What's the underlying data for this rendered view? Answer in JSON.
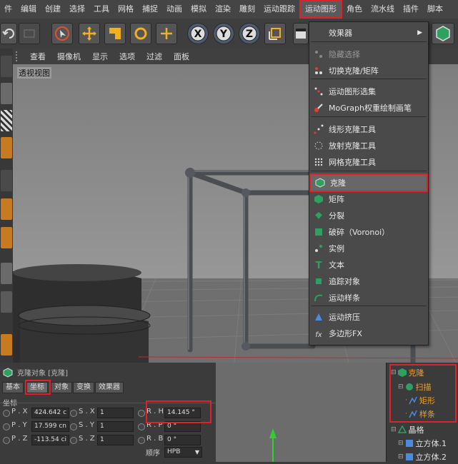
{
  "menubar": {
    "items": [
      "件",
      "编辑",
      "创建",
      "选择",
      "工具",
      "网格",
      "捕捉",
      "动画",
      "模拟",
      "渲染",
      "雕刻",
      "运动跟踪",
      "运动图形",
      "角色",
      "流水线",
      "插件",
      "脚本"
    ],
    "active_index": 12
  },
  "viewport_menu": [
    "查看",
    "摄像机",
    "显示",
    "选项",
    "过滤",
    "面板"
  ],
  "viewport_label": "透视视图",
  "dropdown": {
    "items": [
      {
        "label": "效果器",
        "icon": "submenu-arrow",
        "type": "submenu"
      },
      {
        "label": "隐藏选择",
        "icon": "hide-selection-icon",
        "type": "disabled"
      },
      {
        "label": "切换克隆/矩阵",
        "icon": "toggle-clone-matrix-icon",
        "type": "normal"
      },
      {
        "label": "运动图形选集",
        "icon": "mograph-selection-icon",
        "type": "normal"
      },
      {
        "label": "MoGraph权重绘制画笔",
        "icon": "weight-brush-icon",
        "type": "normal"
      },
      {
        "label": "线形克隆工具",
        "icon": "linear-clone-icon",
        "type": "normal"
      },
      {
        "label": "放射克隆工具",
        "icon": "radial-clone-icon",
        "type": "normal"
      },
      {
        "label": "网格克隆工具",
        "icon": "grid-clone-icon",
        "type": "normal"
      },
      {
        "label": "克隆",
        "icon": "cloner-icon",
        "type": "highlight"
      },
      {
        "label": "矩阵",
        "icon": "matrix-icon",
        "type": "normal"
      },
      {
        "label": "分裂",
        "icon": "fracture-icon",
        "type": "normal"
      },
      {
        "label": "破碎（Voronoi）",
        "icon": "voronoi-icon",
        "type": "normal"
      },
      {
        "label": "实例",
        "icon": "instance-icon",
        "type": "normal"
      },
      {
        "label": "文本",
        "icon": "text-icon",
        "type": "normal"
      },
      {
        "label": "追踪对象",
        "icon": "tracer-icon",
        "type": "normal"
      },
      {
        "label": "运动样条",
        "icon": "mospline-icon",
        "type": "normal"
      },
      {
        "label": "运动挤压",
        "icon": "moextrude-icon",
        "type": "normal"
      },
      {
        "label": "多边形FX",
        "icon": "polyfx-icon",
        "type": "normal"
      }
    ]
  },
  "props": {
    "title": "克隆对象 [克隆]",
    "tabs": [
      "基本",
      "坐标",
      "对象",
      "变换",
      "效果器"
    ],
    "active_tab": "坐标",
    "section": "坐标",
    "rows": [
      {
        "p_label": "P . X",
        "p_val": "424.642 c",
        "s_label": "S . X",
        "s_val": "1",
        "r_label": "R . H",
        "r_val": "14.145 °"
      },
      {
        "p_label": "P . Y",
        "p_val": "17.599 cn",
        "s_label": "S . Y",
        "s_val": "1",
        "r_label": "R . P",
        "r_val": "0 °"
      },
      {
        "p_label": "P . Z",
        "p_val": "-113.54 ci",
        "s_label": "S . Z",
        "s_val": "1",
        "r_label": "R . B",
        "r_val": "0 °"
      }
    ],
    "order_label": "顺序",
    "order_value": "HPB"
  },
  "objects": [
    {
      "label": "克隆",
      "level": 0,
      "color": "#f0a020"
    },
    {
      "label": "扫描",
      "level": 1,
      "color": "#f0a020"
    },
    {
      "label": "矩形",
      "level": 2,
      "color": "#f0a020"
    },
    {
      "label": "样条",
      "level": 2,
      "color": "#f0a020"
    },
    {
      "label": "晶格",
      "level": 0,
      "color": "#e0e0e0"
    },
    {
      "label": "立方体.1",
      "level": 1,
      "color": "#e0e0e0"
    },
    {
      "label": "立方体.2",
      "level": 1,
      "color": "#e0e0e0"
    }
  ],
  "colors": {
    "highlight_red": "#e0202a",
    "object_orange": "#f0a020"
  }
}
